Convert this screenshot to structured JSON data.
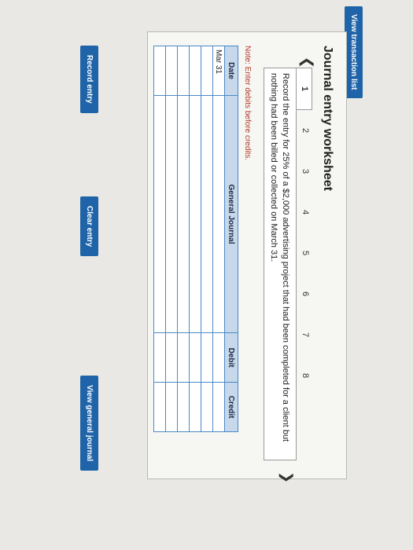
{
  "toolbar": {
    "view_transactions_label": "View transaction list"
  },
  "worksheet": {
    "title": "Journal entry worksheet",
    "prev_icon": "chevron-left-icon",
    "next_icon": "chevron-right-icon",
    "tabs": [
      "1",
      "2",
      "3",
      "4",
      "5",
      "6",
      "7",
      "8"
    ],
    "active_tab": "1",
    "prompt": "Record the entry for 25% of a $2,000 advertising project that had been completed for a client but nothing had been billed or collected on March 31.",
    "note": "Note: Enter debits before credits."
  },
  "journal": {
    "headers": {
      "date": "Date",
      "general_journal": "General Journal",
      "debit": "Debit",
      "credit": "Credit"
    },
    "rows": [
      {
        "date": "Mar 31",
        "account": "",
        "debit": "",
        "credit": ""
      },
      {
        "date": "",
        "account": "",
        "debit": "",
        "credit": ""
      },
      {
        "date": "",
        "account": "",
        "debit": "",
        "credit": ""
      },
      {
        "date": "",
        "account": "",
        "debit": "",
        "credit": ""
      },
      {
        "date": "",
        "account": "",
        "debit": "",
        "credit": ""
      },
      {
        "date": "",
        "account": "",
        "debit": "",
        "credit": ""
      }
    ]
  },
  "actions": {
    "record_label": "Record entry",
    "clear_label": "Clear entry",
    "view_general_label": "View general journal"
  },
  "colors": {
    "button": "#1f64a8",
    "header": "#c7d8ea",
    "grid": "#4a88c7"
  }
}
